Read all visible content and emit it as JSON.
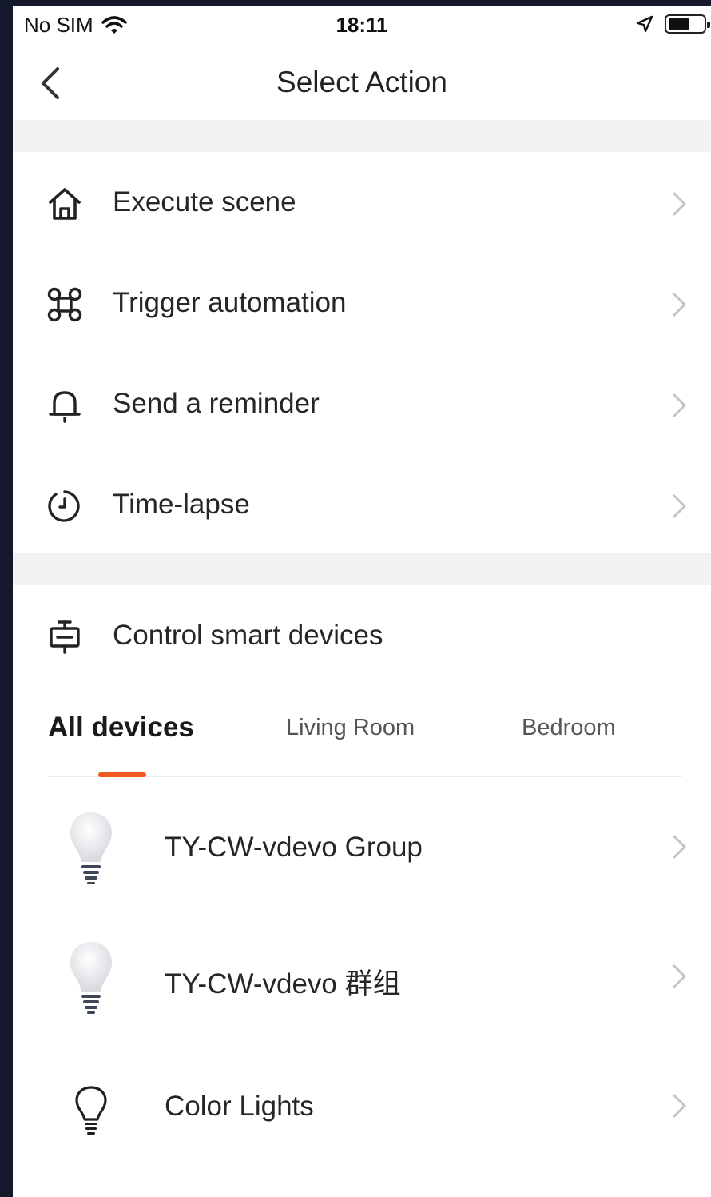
{
  "status_bar": {
    "carrier": "No SIM",
    "time": "18:11"
  },
  "nav": {
    "title": "Select Action",
    "back_icon": "chevron-left-icon"
  },
  "actions": [
    {
      "label": "Execute scene",
      "icon": "home-icon"
    },
    {
      "label": "Trigger automation",
      "icon": "command-icon"
    },
    {
      "label": "Send a reminder",
      "icon": "bell-icon"
    },
    {
      "label": "Time-lapse",
      "icon": "timer-icon"
    }
  ],
  "control": {
    "label": "Control smart devices",
    "icon": "device-icon"
  },
  "tabs": [
    {
      "label": "All devices",
      "active": true
    },
    {
      "label": "Living Room",
      "active": false
    },
    {
      "label": "Bedroom",
      "active": false
    }
  ],
  "devices": [
    {
      "name": "TY-CW-vdevo Group",
      "icon": "bulb-filled-icon"
    },
    {
      "name": "TY-CW-vdevo 群组",
      "icon": "bulb-filled-icon"
    },
    {
      "name": "Color Lights",
      "icon": "bulb-outline-icon"
    }
  ],
  "colors": {
    "accent": "#ee5a1e",
    "section_gap": "#f2f2f2",
    "frame": "#141a2b"
  }
}
